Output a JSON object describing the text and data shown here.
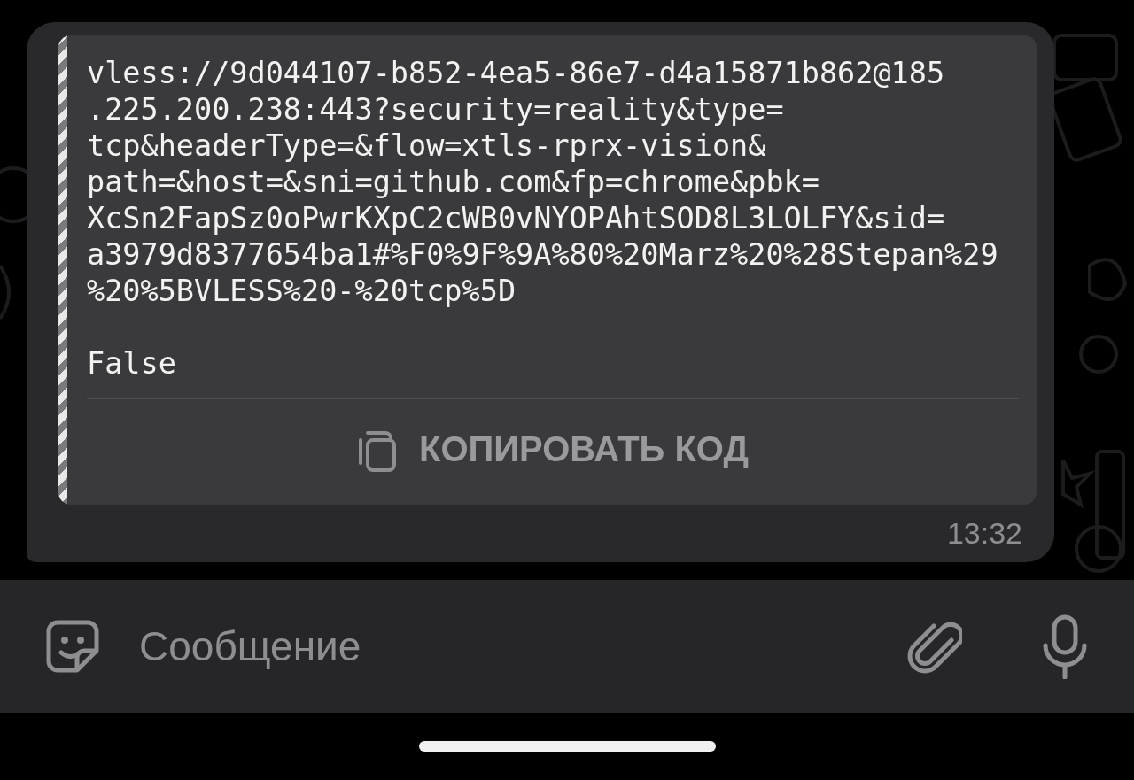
{
  "message": {
    "code_lines": [
      "vless://9d044107-b852-4ea5-86e7-d4a15871b862@185",
      ".225.200.238:443?security=reality&type=",
      "tcp&headerType=&flow=xtls-rprx-vision&",
      "path=&host=&sni=github.com&fp=chrome&pbk=",
      "XcSn2FapSz0oPwrKXpC2cWB0vNYOPAhtSOD8L3LOLFY&sid=",
      "a3979d8377654ba1#%F0%9F%9A%80%20Marz%20%28Stepan%29",
      "%20%5BVLESS%20-%20tcp%5D"
    ],
    "result_line": "False",
    "copy_button": "КОПИРОВАТЬ КОД",
    "time": "13:32"
  },
  "composer": {
    "placeholder": "Сообщение"
  }
}
